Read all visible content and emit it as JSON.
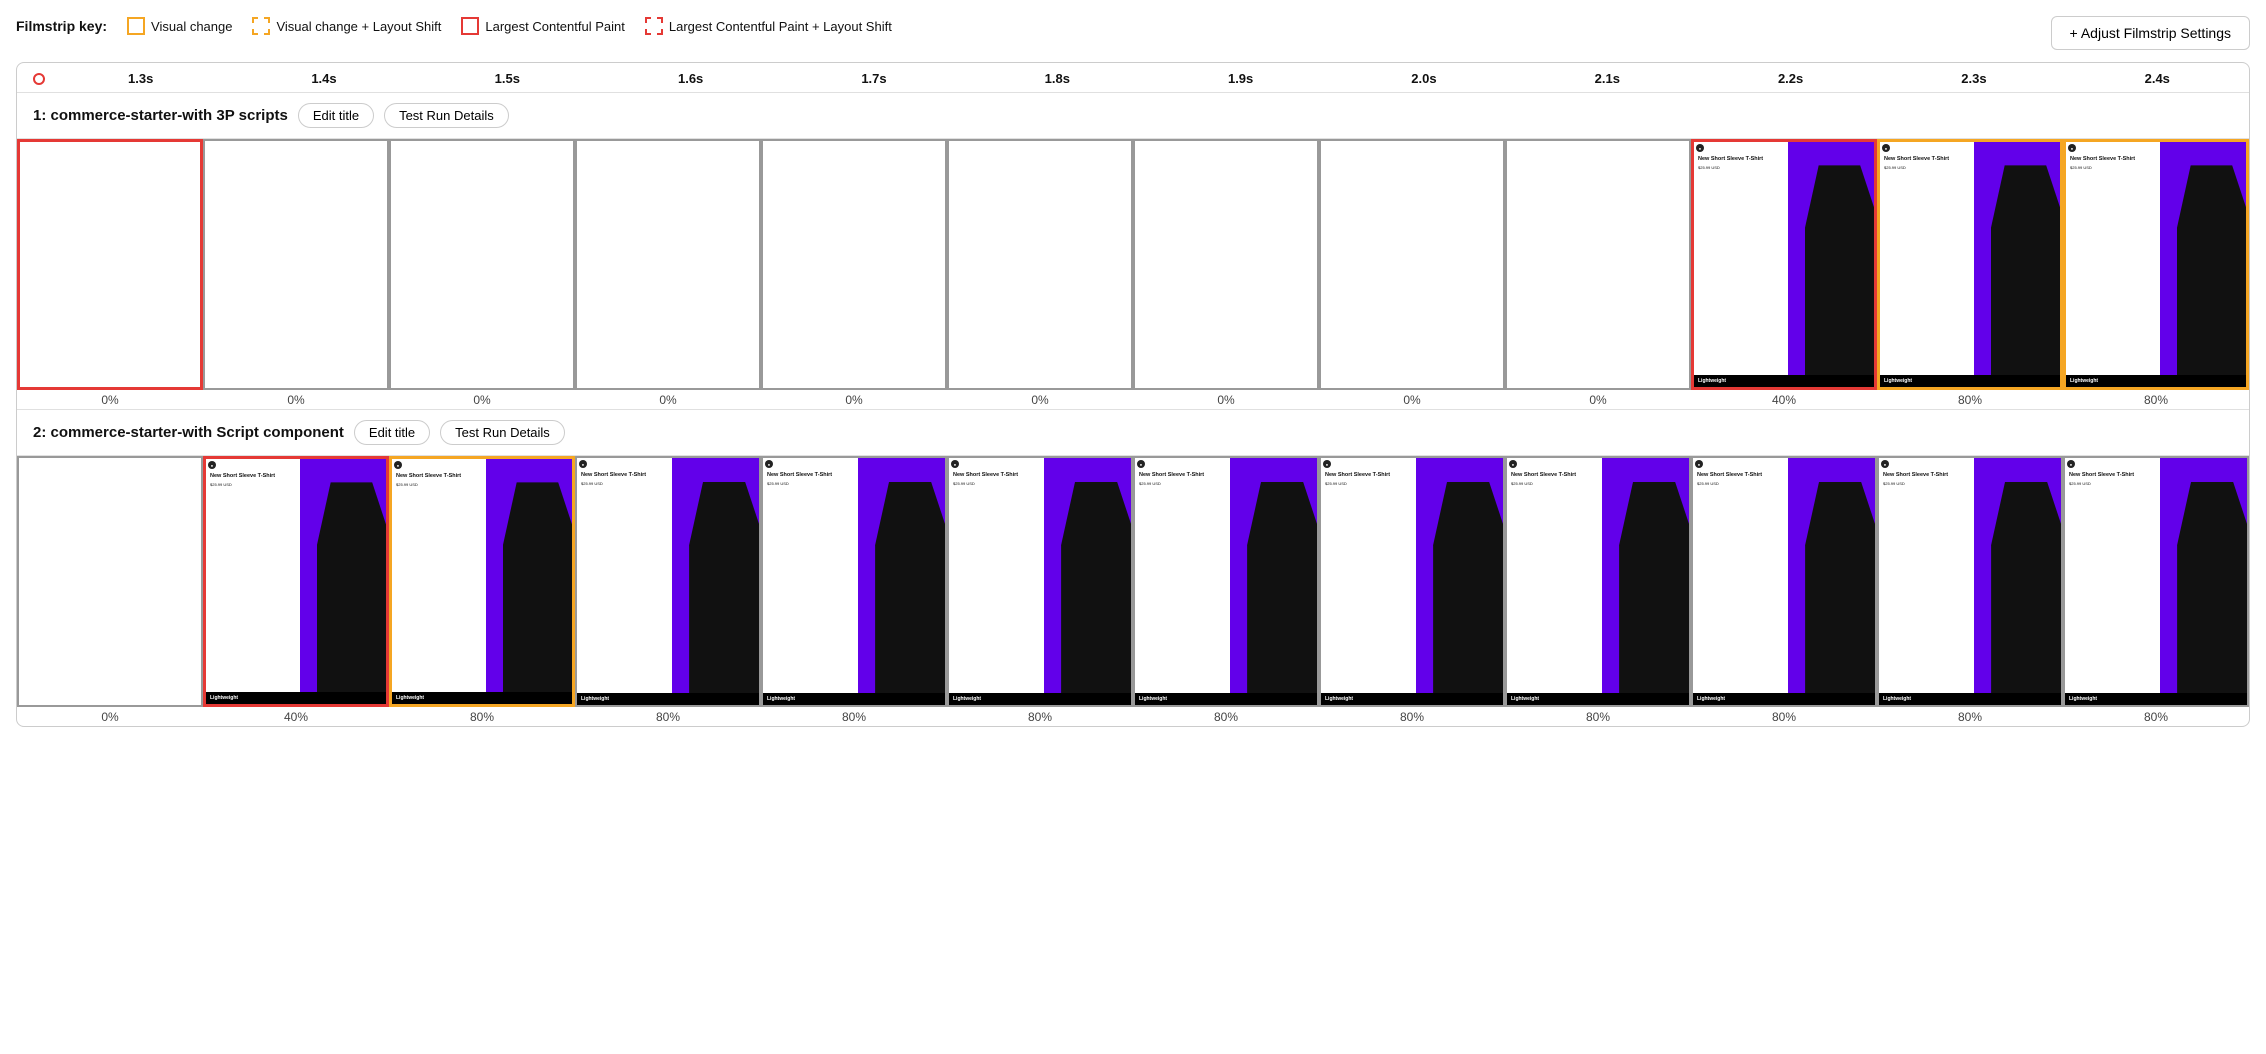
{
  "filmstrip_key": {
    "label": "Filmstrip key:",
    "items": [
      {
        "id": "visual-change",
        "label": "Visual change",
        "border_style": "solid-yellow"
      },
      {
        "id": "visual-change-layout-shift",
        "label": "Visual change + Layout Shift",
        "border_style": "dashed-yellow"
      },
      {
        "id": "lcp",
        "label": "Largest Contentful Paint",
        "border_style": "solid-red"
      },
      {
        "id": "lcp-layout-shift",
        "label": "Largest Contentful Paint + Layout Shift",
        "border_style": "dashed-red"
      }
    ]
  },
  "adjust_button": "+ Adjust Filmstrip Settings",
  "timeline": {
    "ticks": [
      "1.3s",
      "1.4s",
      "1.5s",
      "1.6s",
      "1.7s",
      "1.8s",
      "1.9s",
      "2.0s",
      "2.1s",
      "2.2s",
      "2.3s",
      "2.4s"
    ]
  },
  "sections": [
    {
      "id": "section1",
      "title": "1: commerce-starter-with 3P scripts",
      "edit_label": "Edit title",
      "details_label": "Test Run Details",
      "frames": [
        {
          "border": "red",
          "empty": true,
          "pct": "0%"
        },
        {
          "border": "none",
          "empty": true,
          "pct": "0%"
        },
        {
          "border": "none",
          "empty": true,
          "pct": "0%"
        },
        {
          "border": "none",
          "empty": true,
          "pct": "0%"
        },
        {
          "border": "none",
          "empty": true,
          "pct": "0%"
        },
        {
          "border": "none",
          "empty": true,
          "pct": "0%"
        },
        {
          "border": "none",
          "empty": true,
          "pct": "0%"
        },
        {
          "border": "none",
          "empty": true,
          "pct": "0%"
        },
        {
          "border": "none",
          "empty": true,
          "pct": "0%"
        },
        {
          "border": "red",
          "empty": false,
          "pct": "40%"
        },
        {
          "border": "yellow",
          "empty": false,
          "pct": "80%"
        },
        {
          "border": "yellow",
          "empty": false,
          "pct": "80%"
        }
      ]
    },
    {
      "id": "section2",
      "title": "2: commerce-starter-with Script component",
      "edit_label": "Edit title",
      "details_label": "Test Run Details",
      "frames": [
        {
          "border": "none",
          "empty": true,
          "pct": "0%"
        },
        {
          "border": "red",
          "empty": false,
          "pct": "40%"
        },
        {
          "border": "yellow",
          "empty": false,
          "pct": "80%"
        },
        {
          "border": "none",
          "empty": false,
          "pct": "80%"
        },
        {
          "border": "none",
          "empty": false,
          "pct": "80%"
        },
        {
          "border": "none",
          "empty": false,
          "pct": "80%"
        },
        {
          "border": "none",
          "empty": false,
          "pct": "80%"
        },
        {
          "border": "none",
          "empty": false,
          "pct": "80%"
        },
        {
          "border": "none",
          "empty": false,
          "pct": "80%"
        },
        {
          "border": "none",
          "empty": false,
          "pct": "80%"
        },
        {
          "border": "none",
          "empty": false,
          "pct": "80%"
        },
        {
          "border": "none",
          "empty": false,
          "pct": "80%"
        }
      ]
    }
  ],
  "product": {
    "title": "New Short Sleeve T-Shirt",
    "price": "$25.99 USD",
    "bottom_text": "Lightweight"
  }
}
